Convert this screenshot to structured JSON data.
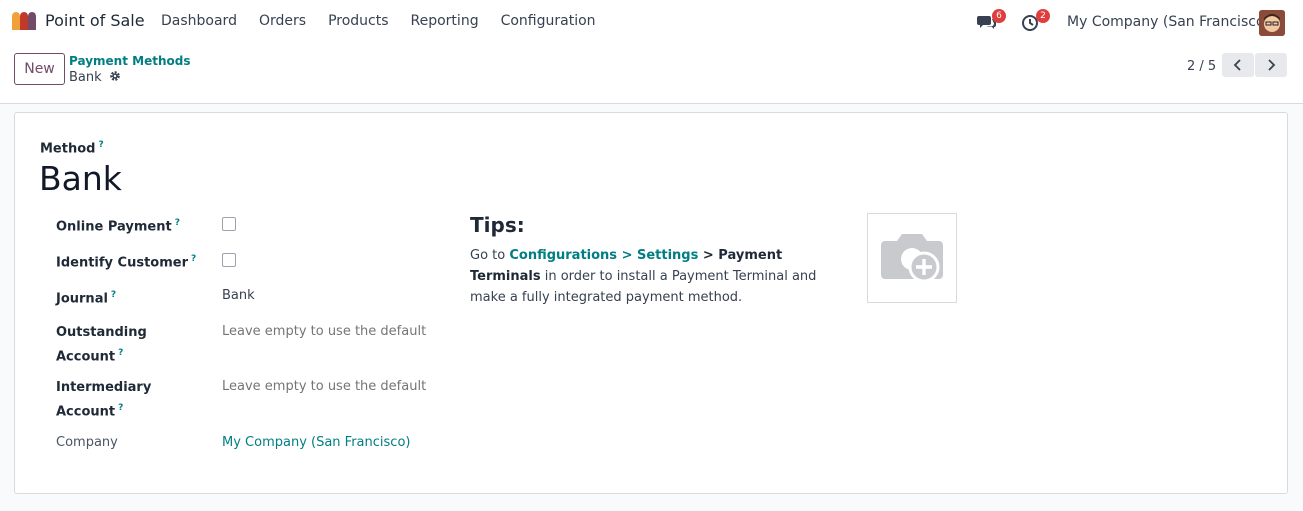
{
  "navbar": {
    "app_name": "Point of Sale",
    "menu": [
      "Dashboard",
      "Orders",
      "Products",
      "Reporting",
      "Configuration"
    ],
    "messages_count": "6",
    "activities_count": "2",
    "company": "My Company (San Francisco)"
  },
  "control_panel": {
    "new_label": "New",
    "breadcrumb_parent": "Payment Methods",
    "breadcrumb_current": "Bank",
    "pager": "2 / 5"
  },
  "form": {
    "method_label": "Method",
    "help_mark": "?",
    "method_name": "Bank",
    "fields": {
      "online_payment": {
        "label": "Online Payment",
        "checked": false
      },
      "identify_customer": {
        "label": "Identify Customer",
        "checked": false
      },
      "journal": {
        "label": "Journal",
        "value": "Bank"
      },
      "outstanding_account": {
        "label_line1": "Outstanding",
        "label_line2": "Account",
        "placeholder": "Leave empty to use the default account from the company setting"
      },
      "intermediary_account": {
        "label_line1": "Intermediary",
        "label_line2": "Account",
        "placeholder": "Leave empty to use the default account from the company setting"
      },
      "company": {
        "label": "Company",
        "value": "My Company (San Francisco)"
      }
    },
    "tips": {
      "title": "Tips:",
      "prefix": "Go to ",
      "link": "Configurations > Settings",
      "bold": " > Payment Terminals",
      "suffix": " in order to install a Payment Terminal and make a fully integrated payment method."
    }
  },
  "colors": {
    "brand": "#714b67",
    "link": "#017e84",
    "badge": "#e03d3d"
  },
  "icons": {
    "app": "point-of-sale-logo",
    "messages": "chat-bubbles-icon",
    "activities": "clock-icon",
    "settings": "gear-icon",
    "prev": "chevron-left-icon",
    "next": "chevron-right-icon",
    "image": "camera-plus-icon"
  }
}
